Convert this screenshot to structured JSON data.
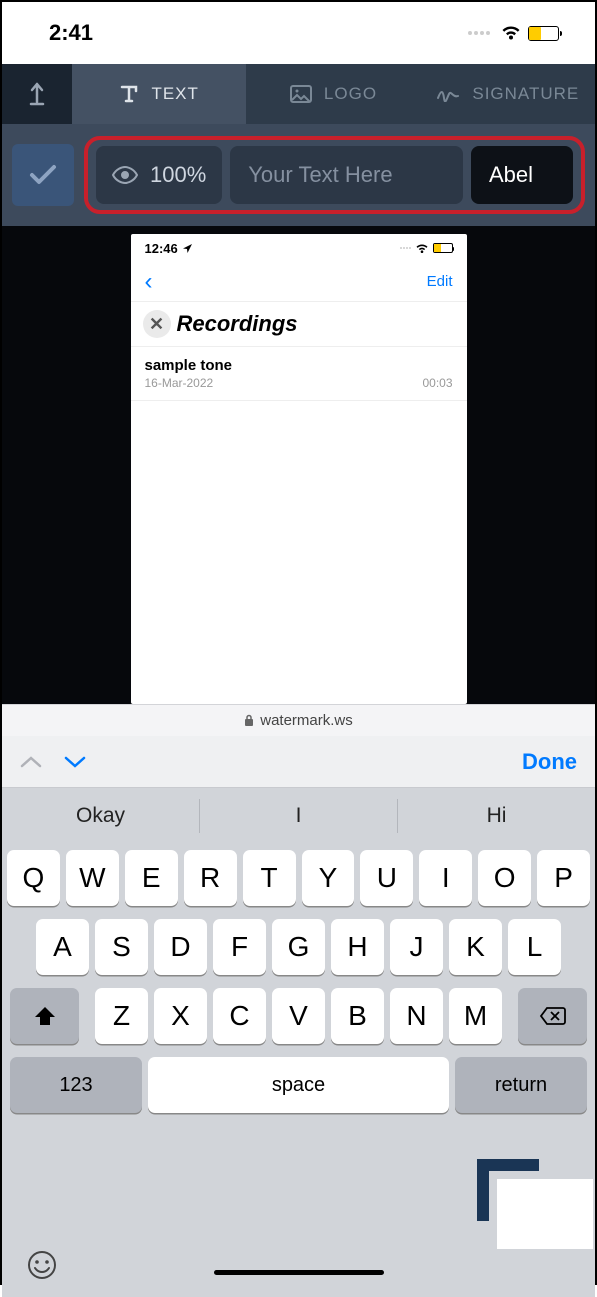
{
  "status": {
    "time": "2:41"
  },
  "tabs": {
    "text": "TEXT",
    "logo": "LOGO",
    "signature": "SIGNATURE"
  },
  "toolbar": {
    "opacity": "100%",
    "placeholder": "Your Text Here",
    "font": "Abel"
  },
  "preview": {
    "time": "12:46",
    "edit": "Edit",
    "title": "Recordings",
    "item": {
      "name": "sample tone",
      "date": "16-Mar-2022",
      "duration": "00:03"
    }
  },
  "urlbar": {
    "domain": "watermark.ws"
  },
  "keyboard": {
    "done": "Done",
    "suggestions": [
      "Okay",
      "I",
      "Hi"
    ],
    "row1": [
      "Q",
      "W",
      "E",
      "R",
      "T",
      "Y",
      "U",
      "I",
      "O",
      "P"
    ],
    "row2": [
      "A",
      "S",
      "D",
      "F",
      "G",
      "H",
      "J",
      "K",
      "L"
    ],
    "row3": [
      "Z",
      "X",
      "C",
      "V",
      "B",
      "N",
      "M"
    ],
    "k123": "123",
    "space": "space",
    "return": "return"
  }
}
